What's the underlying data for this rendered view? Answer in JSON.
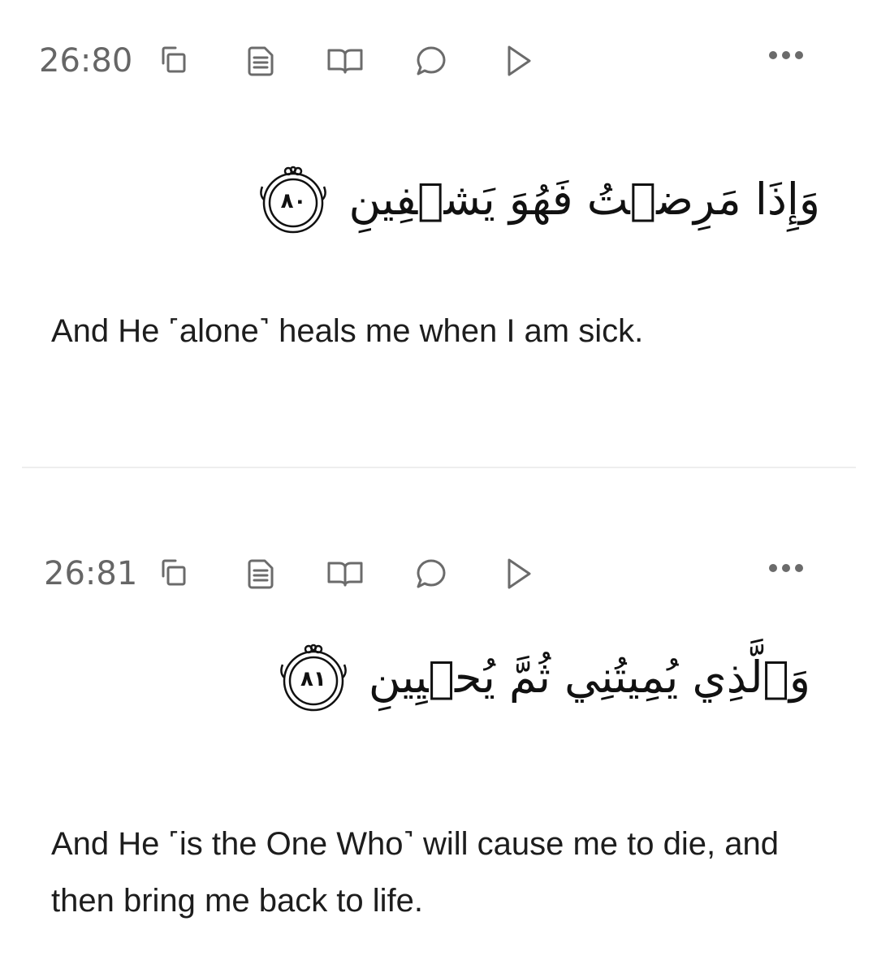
{
  "verses": [
    {
      "key": "26:80",
      "arabic": "وَإِذَا مَرِضۡتُ فَهُوَ يَشۡفِينِ",
      "ayah_number": "٨٠",
      "translation": "And He ˹alone˺ heals me when I am sick."
    },
    {
      "key": "26:81",
      "arabic": "وَٱلَّذِي يُمِيتُنِي ثُمَّ يُحۡيِينِ",
      "ayah_number": "٨١",
      "translation": "And He ˹is the One Who˺ will cause me to die, and then bring me back to life."
    }
  ],
  "toolbar_icons": [
    "copy-icon",
    "tafsir-icon",
    "book-icon",
    "comment-icon",
    "play-icon",
    "more-icon"
  ],
  "colors": {
    "icon": "#6b6b6b",
    "text": "#1d1d1d",
    "muted": "#666666",
    "divider": "#eeeeee"
  }
}
